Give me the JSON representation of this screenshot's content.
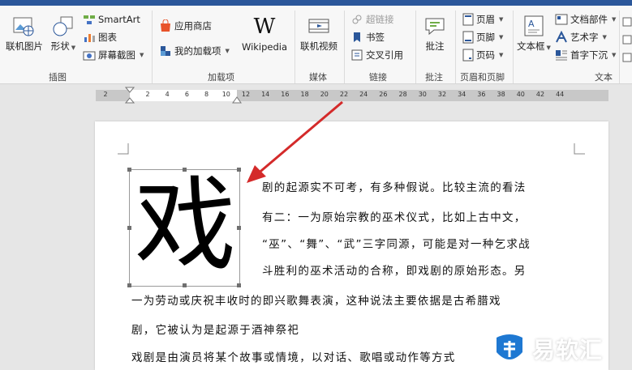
{
  "ribbon": {
    "groups": {
      "illustrations": "插图",
      "addins": "加载项",
      "media": "媒体",
      "links": "链接",
      "comments": "批注",
      "header_footer": "页眉和页脚",
      "text": "文本"
    },
    "buttons": {
      "online_pictures": "联机图片",
      "shapes": "形状",
      "smartart": "SmartArt",
      "chart": "图表",
      "screenshot": "屏幕截图",
      "store": "应用商店",
      "my_addins": "我的加载项",
      "wikipedia": "Wikipedia",
      "online_video": "联机视频",
      "hyperlink": "超链接",
      "bookmark": "书签",
      "cross_reference": "交叉引用",
      "comment": "批注",
      "header": "页眉",
      "footer": "页脚",
      "page_number": "页码",
      "textbox": "文本框",
      "quick_parts": "文档部件",
      "wordart": "艺术字",
      "drop_cap": "首字下沉"
    },
    "wikipedia_glyph": "W"
  },
  "ruler": {
    "left_labels": [
      "2"
    ],
    "labels": [
      "2",
      "4",
      "6",
      "8",
      "10",
      "12",
      "14",
      "16",
      "18",
      "20",
      "22",
      "24",
      "26",
      "28",
      "30",
      "32",
      "34",
      "36",
      "38",
      "40",
      "42",
      "44"
    ]
  },
  "document": {
    "image_char": "戏",
    "lines": [
      "剧的起源实不可考，有多种假说。比较主流的看法",
      "有二：一为原始宗教的巫术仪式，比如上古中文，",
      "“巫”、“舞”、“武”三字同源，可能是对一种乞求战",
      "斗胜利的巫术活动的合称，即戏剧的原始形态。另",
      "一为劳动或庆祝丰收时的即兴歌舞表演，这种说法主要依据是古希腊戏",
      "剧，它被认为是起源于酒神祭祀",
      "戏剧是由演员将某个故事或情境，以对话、歌唱或动作等方式"
    ]
  },
  "watermark": {
    "text": "易软汇"
  },
  "colors": {
    "accent": "#2b579a",
    "arrow": "#d42a2a",
    "watermark_blue": "#1e78d2"
  }
}
